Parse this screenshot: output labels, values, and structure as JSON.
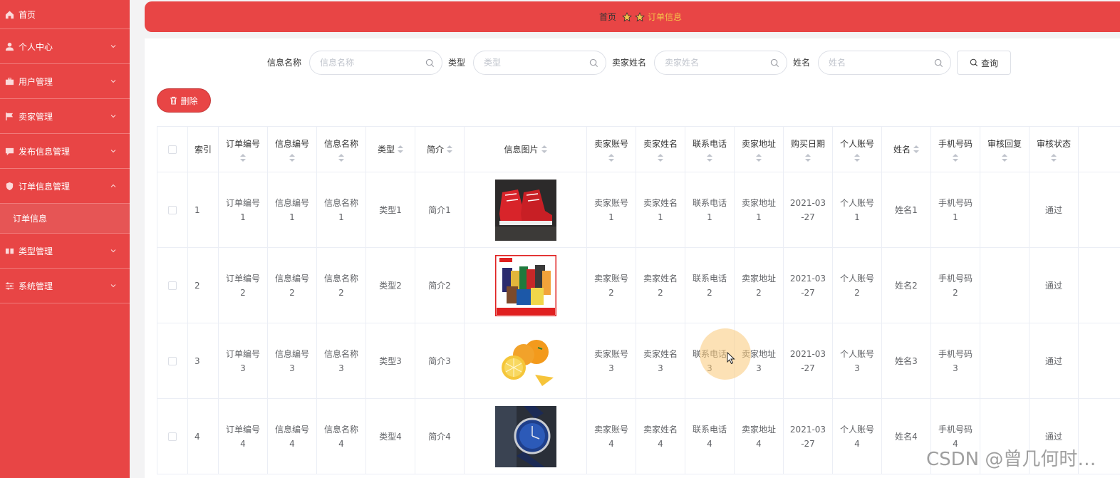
{
  "sidebar": {
    "items": [
      {
        "label": "首页",
        "icon": "home-icon"
      },
      {
        "label": "个人中心",
        "icon": "user-icon"
      },
      {
        "label": "用户管理",
        "icon": "briefcase-icon"
      },
      {
        "label": "卖家管理",
        "icon": "flag-icon"
      },
      {
        "label": "发布信息管理",
        "icon": "chat-icon"
      },
      {
        "label": "订单信息管理",
        "icon": "shield-icon"
      },
      {
        "label": "类型管理",
        "icon": "grid-icon"
      },
      {
        "label": "系统管理",
        "icon": "sliders-icon"
      }
    ],
    "submenu": {
      "label": "订单信息"
    }
  },
  "header": {
    "breadcrumb_home": "首页",
    "breadcrumb_current": "订单信息"
  },
  "search": {
    "fields": [
      {
        "label": "信息名称",
        "placeholder": "信息名称"
      },
      {
        "label": "类型",
        "placeholder": "类型"
      },
      {
        "label": "卖家姓名",
        "placeholder": "卖家姓名"
      },
      {
        "label": "姓名",
        "placeholder": "姓名"
      }
    ],
    "query_label": "查询"
  },
  "toolbar": {
    "delete_label": "删除"
  },
  "table": {
    "headers": [
      "索引",
      "订单编号",
      "信息编号",
      "信息名称",
      "类型",
      "简介",
      "信息图片",
      "卖家账号",
      "卖家姓名",
      "联系电话",
      "卖家地址",
      "购买日期",
      "个人账号",
      "姓名",
      "手机号码",
      "审核回复",
      "审核状态"
    ],
    "rows": [
      {
        "index": "1",
        "order_no": "订单编号\n1",
        "info_no": "信息编号\n1",
        "info_name": "信息名称\n1",
        "type": "类型1",
        "intro": "简介1",
        "image": "red-sneakers",
        "seller_account": "卖家账号\n1",
        "seller_name": "卖家姓名\n1",
        "phone": "联系电话\n1",
        "seller_address": "卖家地址\n1",
        "date": "2021-03\n-27",
        "personal_account": "个人账号\n1",
        "name": "姓名1",
        "mobile": "手机号码\n1",
        "review_reply": "",
        "status": "通过"
      },
      {
        "index": "2",
        "order_no": "订单编号\n2",
        "info_no": "信息编号\n2",
        "info_name": "信息名称\n2",
        "type": "类型2",
        "intro": "简介2",
        "image": "snack-box",
        "seller_account": "卖家账号\n2",
        "seller_name": "卖家姓名\n2",
        "phone": "联系电话\n2",
        "seller_address": "卖家地址\n2",
        "date": "2021-03\n-27",
        "personal_account": "个人账号\n2",
        "name": "姓名2",
        "mobile": "手机号码\n2",
        "review_reply": "",
        "status": "通过"
      },
      {
        "index": "3",
        "order_no": "订单编号\n3",
        "info_no": "信息编号\n3",
        "info_name": "信息名称\n3",
        "type": "类型3",
        "intro": "简介3",
        "image": "oranges",
        "seller_account": "卖家账号\n3",
        "seller_name": "卖家姓名\n3",
        "phone": "联系电话\n3",
        "seller_address": "卖家地址\n3",
        "date": "2021-03\n-27",
        "personal_account": "个人账号\n3",
        "name": "姓名3",
        "mobile": "手机号码\n3",
        "review_reply": "",
        "status": "通过"
      },
      {
        "index": "4",
        "order_no": "订单编号\n4",
        "info_no": "信息编号\n4",
        "info_name": "信息名称\n4",
        "type": "类型4",
        "intro": "简介4",
        "image": "blue-watch",
        "seller_account": "卖家账号\n4",
        "seller_name": "卖家姓名\n4",
        "phone": "联系电话\n4",
        "seller_address": "卖家地址\n4",
        "date": "2021-03\n-27",
        "personal_account": "个人账号\n4",
        "name": "姓名4",
        "mobile": "手机号码\n4",
        "review_reply": "",
        "status": "通过"
      }
    ]
  },
  "watermark": "CSDN @曾几何时…",
  "colors": {
    "primary": "#e84545",
    "accent": "#f5c24a",
    "border": "#ebeef5"
  }
}
